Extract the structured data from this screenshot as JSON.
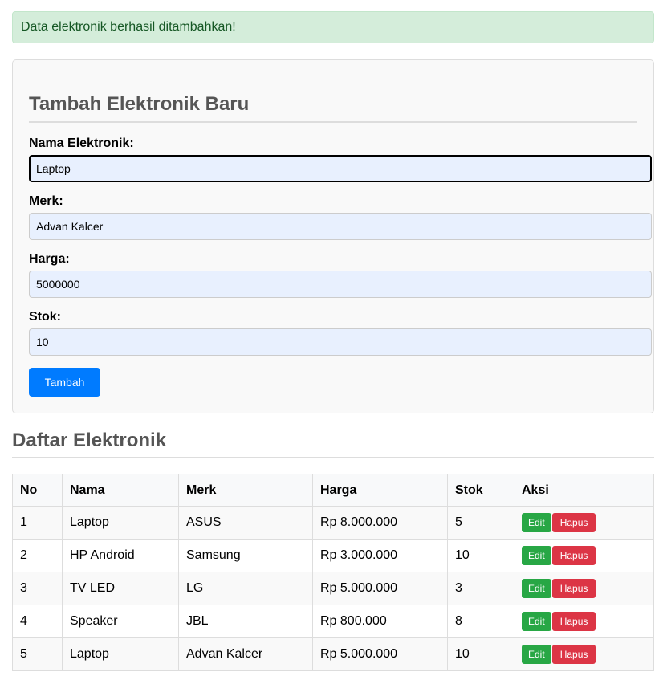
{
  "alert": {
    "message": "Data elektronik berhasil ditambahkan!"
  },
  "form": {
    "title": "Tambah Elektronik Baru",
    "fields": [
      {
        "label": "Nama Elektronik:",
        "value": "Laptop"
      },
      {
        "label": "Merk:",
        "value": "Advan Kalcer"
      },
      {
        "label": "Harga:",
        "value": "5000000"
      },
      {
        "label": "Stok:",
        "value": "10"
      }
    ],
    "submit_label": "Tambah"
  },
  "list": {
    "title": "Daftar Elektronik",
    "columns": [
      "No",
      "Nama",
      "Merk",
      "Harga",
      "Stok",
      "Aksi"
    ],
    "rows": [
      [
        "1",
        "Laptop",
        "ASUS",
        "Rp 8.000.000",
        "5"
      ],
      [
        "2",
        "HP Android",
        "Samsung",
        "Rp 3.000.000",
        "10"
      ],
      [
        "3",
        "TV LED",
        "LG",
        "Rp 5.000.000",
        "3"
      ],
      [
        "4",
        "Speaker",
        "JBL",
        "Rp 800.000",
        "8"
      ],
      [
        "5",
        "Laptop",
        "Advan Kalcer",
        "Rp 5.000.000",
        "10"
      ]
    ],
    "edit_label": "Edit",
    "delete_label": "Hapus"
  },
  "colors": {
    "primary": "#007bff",
    "success": "#28a745",
    "danger": "#dc3545",
    "alert_bg": "#d4edda"
  }
}
